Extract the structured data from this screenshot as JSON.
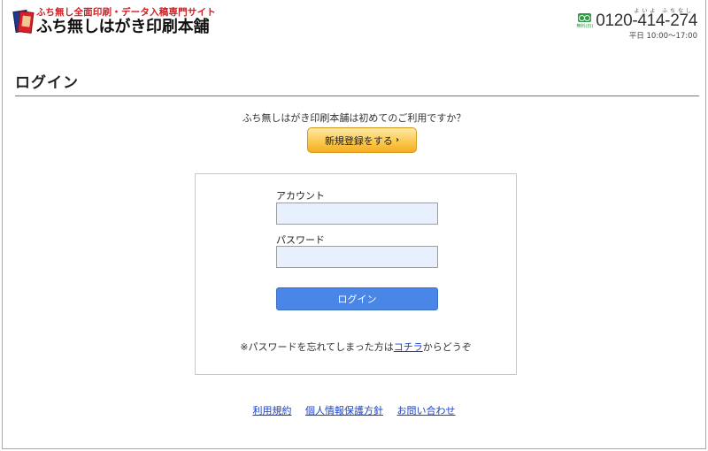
{
  "header": {
    "tagline": "ふち無し全面印刷・データ入稿専門サイト",
    "site_name": "ふち無しはがき印刷本舗",
    "phone_ruby": "よいよ ふちなし",
    "freedial_label": "無料(日)",
    "phone_number": "0120-414-274",
    "phone_hours": "平日 10:00〜17:00"
  },
  "page": {
    "title": "ログイン"
  },
  "register": {
    "prompt": "ふち無しはがき印刷本舗は初めてのご利用ですか？",
    "button_label": "新規登録をする",
    "button_chevron": "›"
  },
  "login_form": {
    "account_label": "アカウント",
    "account_value": "",
    "password_label": "パスワード",
    "password_value": "",
    "submit_label": "ログイン",
    "forgot_prefix": "※パスワードを忘れてしまった方は",
    "forgot_link": "コチラ",
    "forgot_suffix": "からどうぞ"
  },
  "footer": {
    "links": [
      "利用規約",
      "個人情報保護方針",
      "お問い合わせ"
    ]
  },
  "colors": {
    "brand_red": "#d21d23",
    "brand_blue": "#1d3a8f",
    "register_button": "#fbc64a",
    "login_button": "#4a86e8",
    "input_background": "#e8f0fe",
    "link": "#1a43c9",
    "freedial_green": "#2e9a43"
  }
}
